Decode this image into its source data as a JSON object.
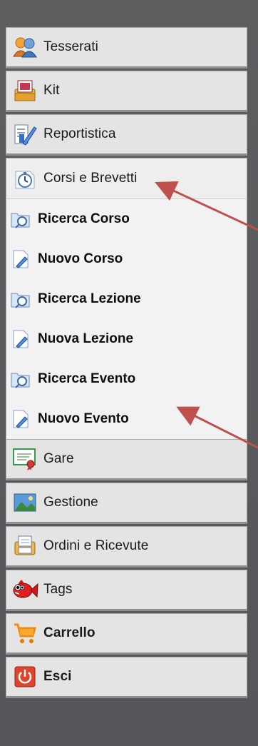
{
  "menu": {
    "items": [
      {
        "label": "Tesserati",
        "icon": "users-icon"
      },
      {
        "label": "Kit",
        "icon": "kit-icon"
      },
      {
        "label": "Reportistica",
        "icon": "report-icon"
      },
      {
        "label": "Corsi e Brevetti",
        "icon": "stopwatch-icon"
      }
    ],
    "submenu": [
      {
        "label": "Ricerca Corso",
        "icon": "search-folder-icon"
      },
      {
        "label": "Nuovo Corso",
        "icon": "new-document-icon"
      },
      {
        "label": "Ricerca Lezione",
        "icon": "search-folder-icon"
      },
      {
        "label": "Nuova Lezione",
        "icon": "new-document-icon"
      },
      {
        "label": "Ricerca Evento",
        "icon": "search-folder-icon"
      },
      {
        "label": "Nuovo Evento",
        "icon": "new-document-icon"
      }
    ],
    "lower": [
      {
        "label": "Gare",
        "icon": "certificate-icon"
      },
      {
        "label": "Gestione",
        "icon": "landscape-icon"
      },
      {
        "label": "Ordini e Ricevute",
        "icon": "printer-icon"
      },
      {
        "label": "Tags",
        "icon": "fish-icon"
      },
      {
        "label": "Carrello",
        "icon": "cart-icon"
      },
      {
        "label": "Esci",
        "icon": "power-icon"
      }
    ]
  },
  "colors": {
    "background": "#5a5b5d",
    "item_bg": "#e4e4e4",
    "submenu_bg": "#f2f2f2",
    "arrow": "#c0504d"
  }
}
